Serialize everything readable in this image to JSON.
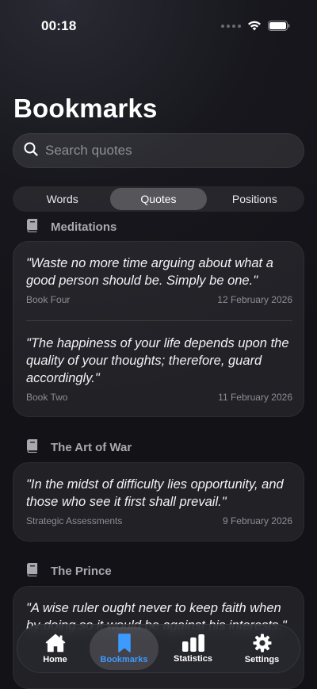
{
  "status": {
    "time": "00:18"
  },
  "page": {
    "title": "Bookmarks"
  },
  "search": {
    "placeholder": "Search quotes"
  },
  "segments": [
    {
      "label": "Words",
      "active": false
    },
    {
      "label": "Quotes",
      "active": true
    },
    {
      "label": "Positions",
      "active": false
    }
  ],
  "groups": [
    {
      "book": "Meditations",
      "quotes": [
        {
          "text": "\"Waste no more time arguing about what a good person should be. Simply be one.\"",
          "source": "Book Four",
          "date": "12 February 2026"
        },
        {
          "text": "\"The happiness of your life depends upon the quality of your thoughts; therefore, guard accordingly.\"",
          "source": "Book Two",
          "date": "11 February 2026"
        }
      ]
    },
    {
      "book": "The Art of War",
      "quotes": [
        {
          "text": "\"In the midst of difficulty lies opportunity, and those who see it first shall prevail.\"",
          "source": "Strategic Assessments",
          "date": "9 February 2026"
        }
      ]
    },
    {
      "book": "The Prince",
      "quotes": [
        {
          "text": "\"A wise ruler ought never to keep faith when by doing so it would be against his interests.\"",
          "source": "",
          "date": ""
        }
      ]
    }
  ],
  "tabs": [
    {
      "label": "Home",
      "icon": "house-icon",
      "active": false
    },
    {
      "label": "Bookmarks",
      "icon": "bookmark-icon",
      "active": true
    },
    {
      "label": "Statistics",
      "icon": "chart-bars-icon",
      "active": false
    },
    {
      "label": "Settings",
      "icon": "gear-icon",
      "active": false
    }
  ],
  "colors": {
    "accent": "#3d9bff",
    "background": "#16161c"
  }
}
